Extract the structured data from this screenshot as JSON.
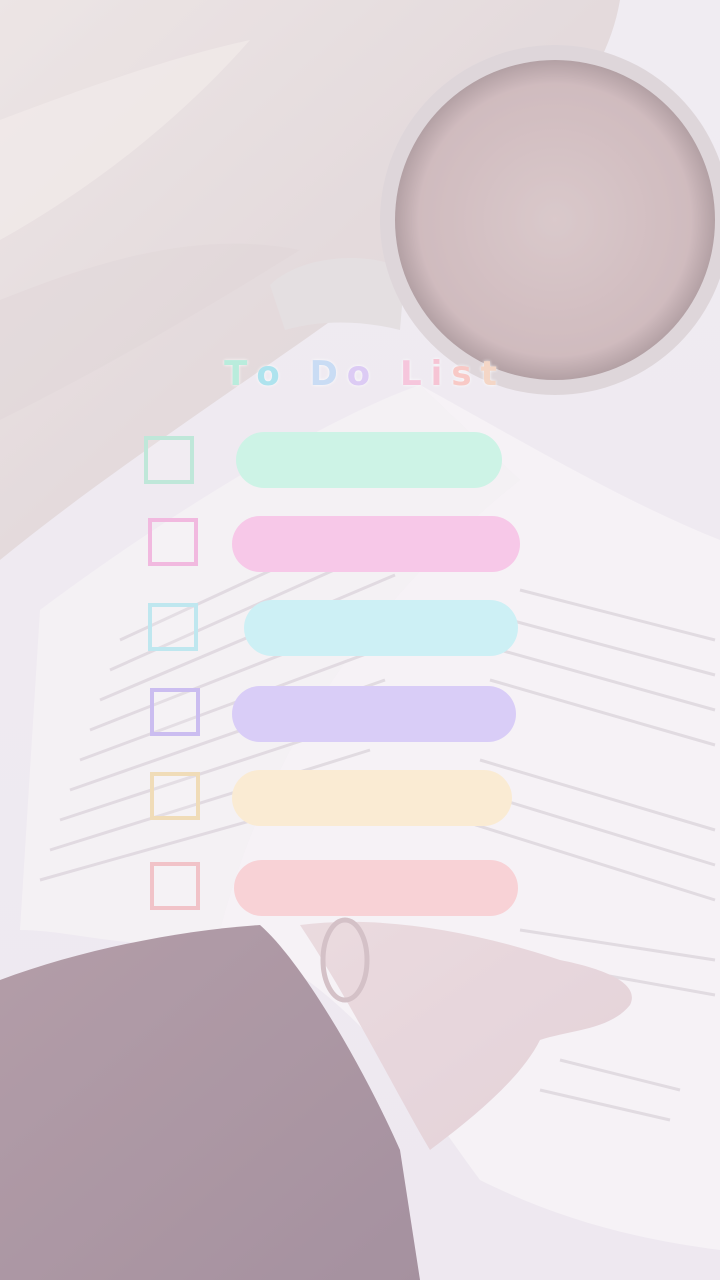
{
  "title": {
    "text": "To Do List",
    "letter_colors": [
      "#b9ecdc",
      "#aee3ee",
      "#b9e6f4",
      "#c9dcf4",
      "#dccbf4",
      "#efc7ea",
      "#f6c6dc",
      "#f6c4d4",
      "#f8c9c6",
      "#f4d6c6"
    ]
  },
  "tasks": [
    {
      "color": "#cdf3e6",
      "checkbox_color": "#bfe7d9",
      "checked": false
    },
    {
      "color": "#f7c8e8",
      "checkbox_color": "#f1b9df",
      "checked": false
    },
    {
      "color": "#cdf0f5",
      "checkbox_color": "#bfe7ef",
      "checked": false
    },
    {
      "color": "#d9cdf7",
      "checkbox_color": "#cbbdf0",
      "checked": false
    },
    {
      "color": "#faebd3",
      "checkbox_color": "#f0dcb8",
      "checked": false
    },
    {
      "color": "#f8d2d6",
      "checkbox_color": "#f1c3c8",
      "checked": false
    }
  ]
}
